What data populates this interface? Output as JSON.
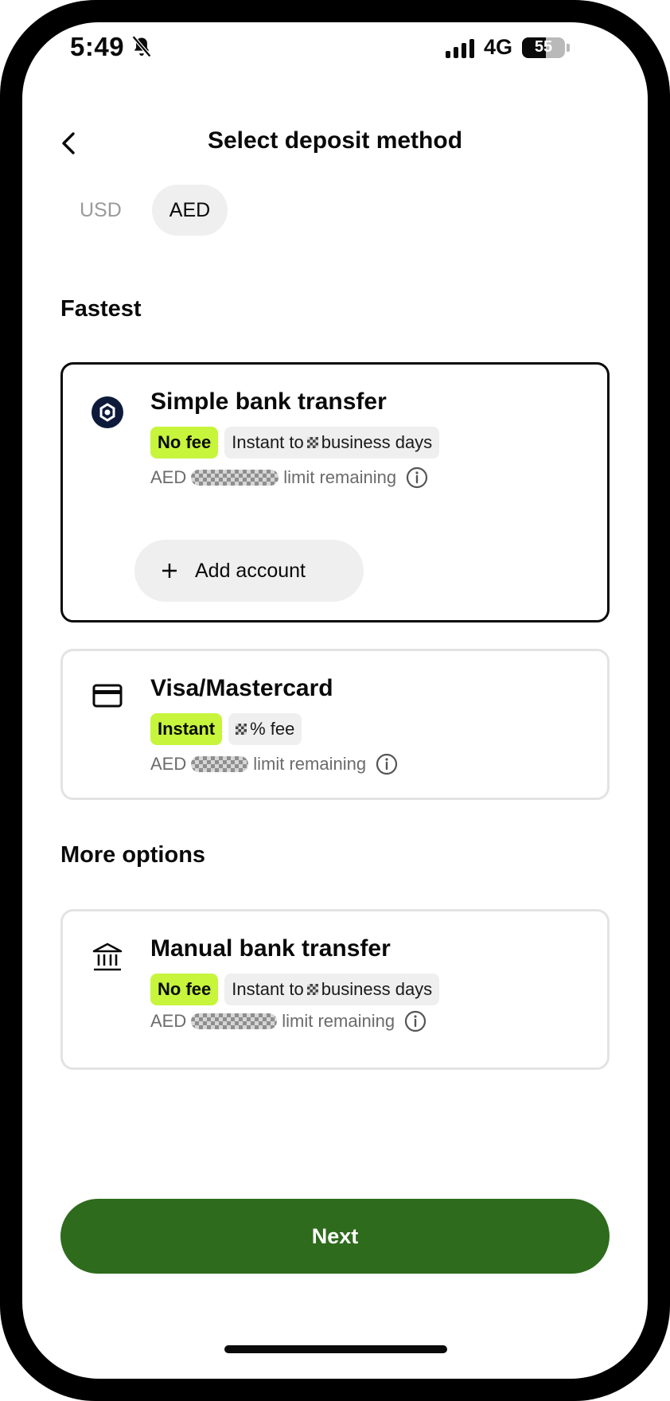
{
  "status_bar": {
    "time": "5:49",
    "network": "4G",
    "battery": "55",
    "battery_level": 0.55,
    "muted_icon": "bell-slash-icon",
    "signal_icon": "signal-bars-icon"
  },
  "header": {
    "title": "Select deposit method",
    "back_icon": "chevron-left-icon"
  },
  "currency_tabs": [
    {
      "label": "USD",
      "active": false
    },
    {
      "label": "AED",
      "active": true
    }
  ],
  "sections": {
    "fastest": "Fastest",
    "more_options": "More options"
  },
  "methods": {
    "simple_bank": {
      "title": "Simple bank transfer",
      "icon": "bank-logo-icon",
      "badge_primary": "No fee",
      "badge_secondary_before": "Instant to",
      "badge_secondary_after": "business days",
      "limit_prefix": "AED",
      "limit_suffix": "limit remaining",
      "add_account_label": "Add account"
    },
    "card": {
      "title": "Visa/Mastercard",
      "icon": "credit-card-icon",
      "badge_primary": "Instant",
      "badge_secondary_after": "% fee",
      "limit_prefix": "AED",
      "limit_suffix": "limit remaining"
    },
    "manual_bank": {
      "title": "Manual bank transfer",
      "icon": "bank-building-icon",
      "badge_primary": "No fee",
      "badge_secondary_before": "Instant to",
      "badge_secondary_after": "business days",
      "limit_prefix": "AED",
      "limit_suffix": "limit remaining"
    }
  },
  "next_label": "Next",
  "colors": {
    "accent_green": "#c6f53c",
    "primary_button": "#2e6b1c",
    "selected_border": "#0a0a0a"
  }
}
